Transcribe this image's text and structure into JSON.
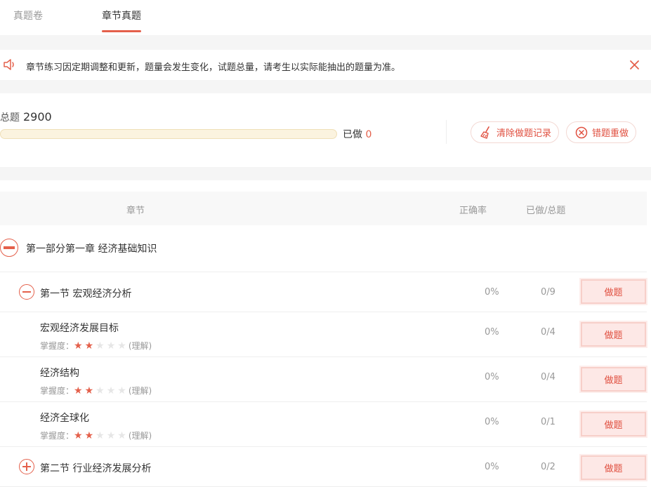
{
  "tabs": [
    {
      "label": "真题卷",
      "active": false
    },
    {
      "label": "章节真题",
      "active": true
    }
  ],
  "notice": {
    "text": "章节练习因定期调整和更新，题量会发生变化，试题总量，请考生以实际能抽出的题量为准。"
  },
  "summary": {
    "total_label": "总题",
    "total": "2900",
    "done_label": "已做",
    "done": "0",
    "progress": 0,
    "clear_label": "清除做题记录",
    "redo_label": "错题重做"
  },
  "table": {
    "col_chapter": "章节",
    "col_accuracy": "正确率",
    "col_done_total": "已做/总题"
  },
  "part": {
    "title": "第一部分第一章 经济基础知识"
  },
  "sections": [
    {
      "title": "第一节 宏观经济分析",
      "accuracy": "0%",
      "count": "0/9",
      "action": "做题"
    },
    {
      "title": "第二节 行业经济发展分析",
      "accuracy": "0%",
      "count": "0/2",
      "action": "做题"
    }
  ],
  "topics": [
    {
      "title": "宏观经济发展目标",
      "mastery_label": "掌握度：",
      "stars": 2,
      "level": "(理解)",
      "accuracy": "0%",
      "count": "0/4",
      "action": "做题"
    },
    {
      "title": "经济结构",
      "mastery_label": "掌握度：",
      "stars": 2,
      "level": "(理解)",
      "accuracy": "0%",
      "count": "0/4",
      "action": "做题"
    },
    {
      "title": "经济全球化",
      "mastery_label": "掌握度：",
      "stars": 2,
      "level": "(理解)",
      "accuracy": "0%",
      "count": "0/1",
      "action": "做题"
    }
  ],
  "colors": {
    "accent": "#e4604b",
    "button_bg": "#fde8e6"
  }
}
